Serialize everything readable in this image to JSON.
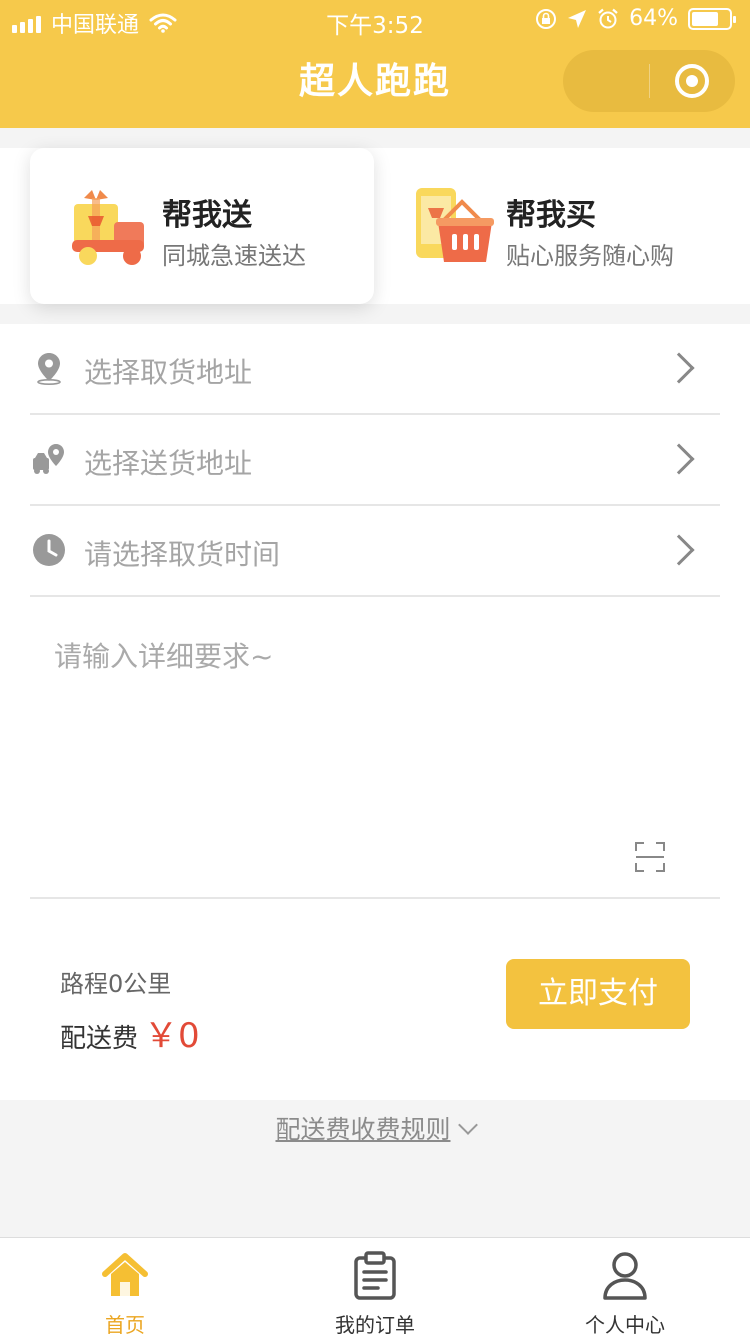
{
  "status_bar": {
    "carrier": "中国联通",
    "time": "下午3:52",
    "battery": "64%"
  },
  "nav": {
    "title": "超人跑跑"
  },
  "services": [
    {
      "title": "帮我送",
      "subtitle": "同城急速送达"
    },
    {
      "title": "帮我买",
      "subtitle": "贴心服务随心购"
    }
  ],
  "form": {
    "pickup_address": "选择取货地址",
    "delivery_address": "选择送货地址",
    "pickup_time": "请选择取货时间",
    "requirements_placeholder": "请输入详细要求~"
  },
  "summary": {
    "route": "路程0公里",
    "fee_label": "配送费",
    "fee_amount": "￥0",
    "pay_button": "立即支付"
  },
  "rules_link": "配送费收费规则",
  "tabs": [
    {
      "label": "首页",
      "icon": "home-icon",
      "active": true
    },
    {
      "label": "我的订单",
      "icon": "order-clipboard-icon",
      "active": false
    },
    {
      "label": "个人中心",
      "icon": "user-icon",
      "active": false
    }
  ],
  "colors": {
    "brand_yellow": "#f6c94b",
    "pay_button": "#f3c23f",
    "price_red": "#e24a37",
    "tab_active": "#eba622"
  }
}
